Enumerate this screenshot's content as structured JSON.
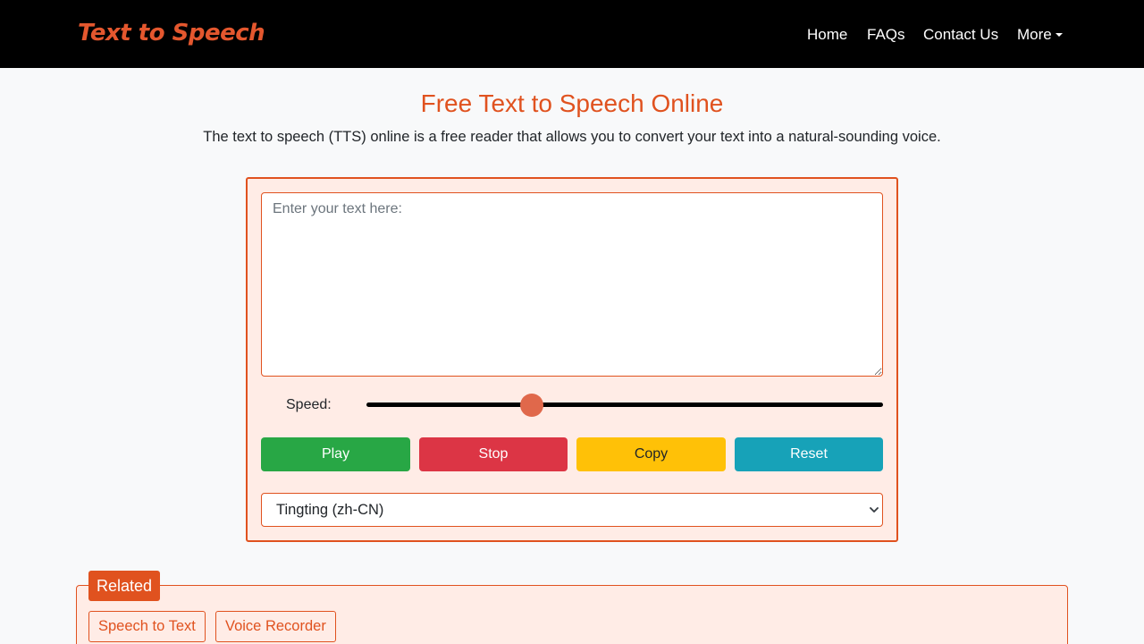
{
  "header": {
    "brand": "Text to Speech",
    "nav": {
      "home": "Home",
      "faqs": "FAQs",
      "contact": "Contact Us",
      "more": "More"
    }
  },
  "main": {
    "title": "Free Text to Speech Online",
    "subtitle": "The text to speech (TTS) online is a free reader that allows you to convert your text into a natural-sounding voice.",
    "textarea": {
      "value": "",
      "placeholder": "Enter your text here:"
    },
    "speed": {
      "label": "Speed:",
      "value_fraction": 0.32
    },
    "buttons": {
      "play": "Play",
      "stop": "Stop",
      "copy": "Copy",
      "reset": "Reset"
    },
    "voice_select": {
      "selected": "Tingting (zh-CN)"
    }
  },
  "related": {
    "title": "Related",
    "links": [
      "Speech to Text",
      "Voice Recorder"
    ]
  },
  "colors": {
    "brand": "#e0521f",
    "panel_bg": "#ffece6",
    "play": "#28a745",
    "stop": "#dc3545",
    "copy": "#ffc107",
    "reset": "#17a2b8"
  }
}
